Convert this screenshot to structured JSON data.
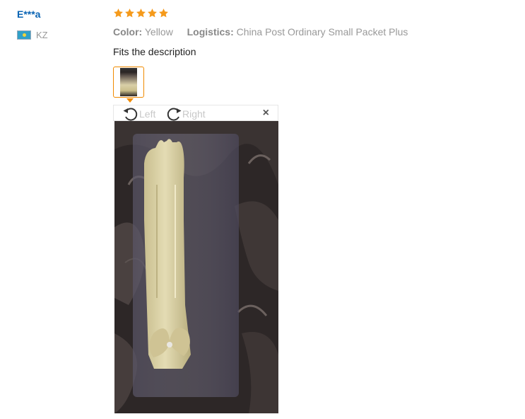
{
  "review": {
    "user_name": "E***a",
    "country_code": "KZ",
    "rating_stars": 5,
    "color_label": "Color:",
    "color_value": "Yellow",
    "logistics_label": "Logistics:",
    "logistics_value": "China Post Ordinary Small Packet Plus",
    "text": "Fits the description"
  },
  "viewer": {
    "rotate_left_label": "Left",
    "rotate_right_label": "Right",
    "close_symbol": "×"
  },
  "icons": {
    "flag": "kazakhstan-flag-icon",
    "star": "star-icon",
    "rotate_left": "rotate-left-icon",
    "rotate_right": "rotate-right-icon",
    "close": "close-icon"
  },
  "colors": {
    "username": "#0a64b4",
    "star": "#f59a1b",
    "thumb_border": "#f08a00"
  }
}
